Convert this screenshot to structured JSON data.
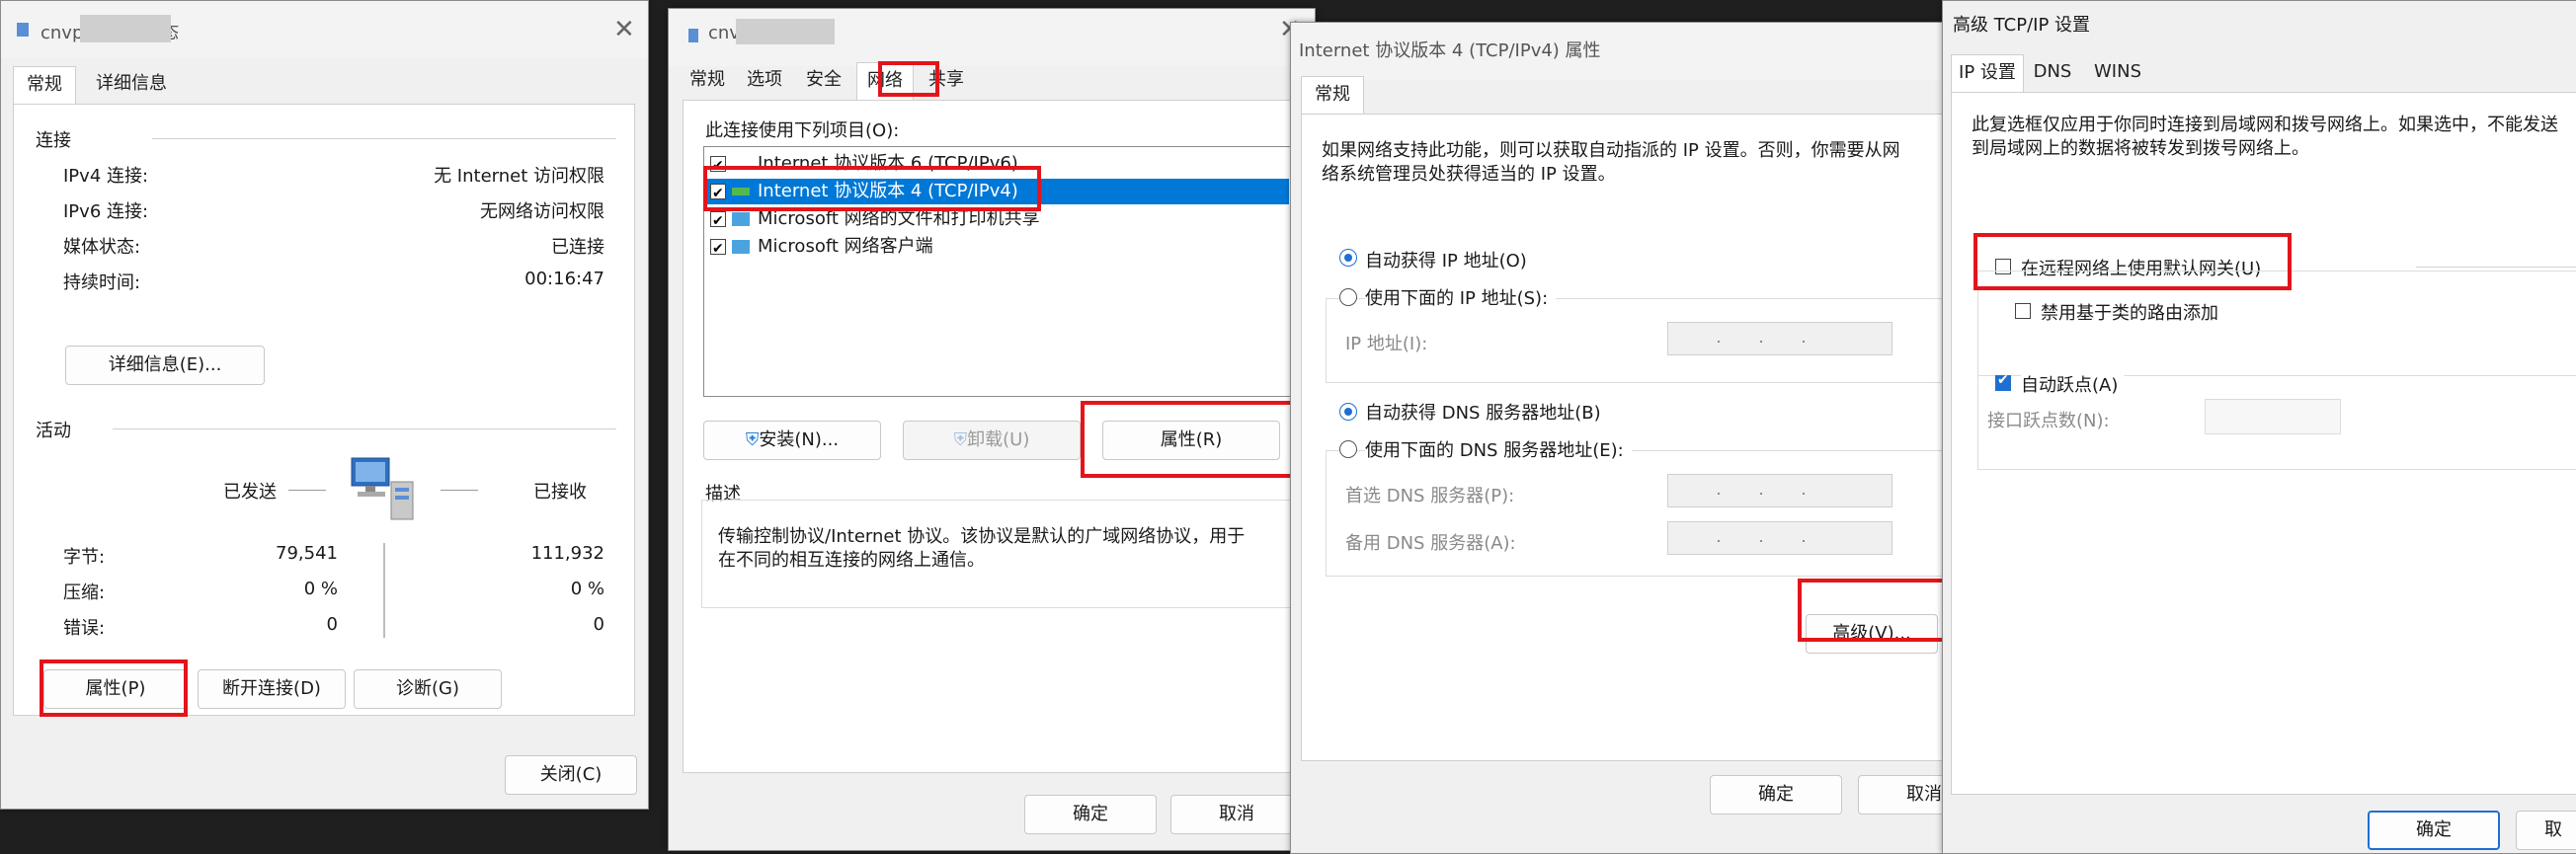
{
  "status_dialog": {
    "title": "cnvpa          com 状态",
    "tabs": [
      "常规",
      "详细信息"
    ],
    "section_connection": "连接",
    "rows": [
      {
        "label": "IPv4 连接:",
        "value": "无 Internet 访问权限"
      },
      {
        "label": "IPv6 连接:",
        "value": "无网络访问权限"
      },
      {
        "label": "媒体状态:",
        "value": "已连接"
      },
      {
        "label": "持续时间:",
        "value": "00:16:47"
      }
    ],
    "details_button": "详细信息(E)...",
    "section_activity": "活动",
    "sent_label": "已发送",
    "received_label": "已接收",
    "stats": [
      {
        "label": "字节:",
        "sent": "79,541",
        "received": "111,932"
      },
      {
        "label": "压缩:",
        "sent": "0 %",
        "received": "0 %"
      },
      {
        "label": "错误:",
        "sent": "0",
        "received": "0"
      }
    ],
    "properties_button": "属性(P)",
    "disconnect_button": "断开连接(D)",
    "diagnose_button": "诊断(G)",
    "close_button": "关闭(C)"
  },
  "properties_dialog": {
    "title": "cnv              n 属性",
    "tabs": [
      "常规",
      "选项",
      "安全",
      "网络",
      "共享"
    ],
    "items_label": "此连接使用下列项目(O):",
    "items": [
      "Internet 协议版本 6 (TCP/IPv6)",
      "Internet 协议版本 4 (TCP/IPv4)",
      "Microsoft 网络的文件和打印机共享",
      "Microsoft 网络客户端"
    ],
    "install_button": "安装(N)...",
    "uninstall_button": "卸载(U)",
    "properties_button": "属性(R)",
    "description_title": "描述",
    "description_text_1": "传输控制协议/Internet 协议。该协议是默认的广域网络协议，用于",
    "description_text_2": "在不同的相互连接的网络上通信。",
    "ok_button": "确定",
    "cancel_button": "取消"
  },
  "ipv4_dialog": {
    "title": "Internet 协议版本 4 (TCP/IPv4) 属性",
    "tab": "常规",
    "intro_1": "如果网络支持此功能，则可以获取自动指派的 IP 设置。否则，你需要从网",
    "intro_2": "络系统管理员处获得适当的 IP 设置。",
    "auto_ip": "自动获得 IP 地址(O)",
    "manual_ip": "使用下面的 IP 地址(S):",
    "ip_address_label": "IP 地址(I):",
    "auto_dns": "自动获得 DNS 服务器地址(B)",
    "manual_dns": "使用下面的 DNS 服务器地址(E):",
    "preferred_dns_label": "首选 DNS 服务器(P):",
    "alternate_dns_label": "备用 DNS 服务器(A):",
    "ip_placeholder": "...",
    "advanced_button": "高级(V)...",
    "ok_button": "确定",
    "cancel_button": "取消"
  },
  "advanced_dialog": {
    "title": "高级 TCP/IP 设置",
    "tabs": [
      "IP 设置",
      "DNS",
      "WINS"
    ],
    "intro_1": "此复选框仅应用于你同时连接到局域网和拨号网络上。如果选中，不能发送",
    "intro_2": "到局域网上的数据将被转发到拨号网络上。",
    "default_gateway": "在远程网络上使用默认网关(U)",
    "disable_class_route": "禁用基于类的路由添加",
    "auto_metric": "自动跃点(A)",
    "interface_metric_label": "接口跃点数(N):",
    "ok_button": "确定",
    "cancel_button": "取"
  }
}
